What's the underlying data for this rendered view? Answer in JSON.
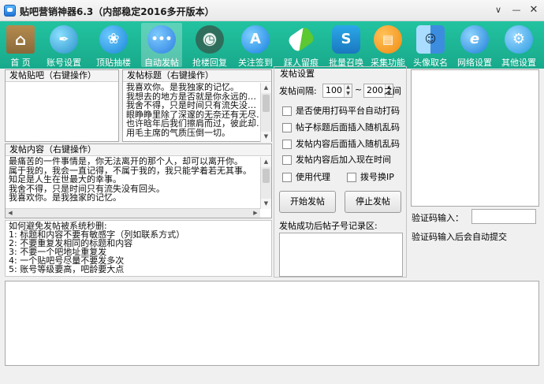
{
  "window": {
    "title": "贴吧营销神器6.3（内部稳定2016多开版本）"
  },
  "toolbar": {
    "items": [
      {
        "label": "首 页",
        "icon": "home-icon",
        "color": "#8a6a3a"
      },
      {
        "label": "账号设置",
        "icon": "feather-icon",
        "color": "#3aa8d8"
      },
      {
        "label": "顶贴抽楼",
        "icon": "bird-icon",
        "color": "#1e9be0"
      },
      {
        "label": "自动发帖",
        "icon": "chat-bubble-icon",
        "color": "#2b8be6"
      },
      {
        "label": "抢楼回复",
        "icon": "clock-icon",
        "color": "#2f6e5c"
      },
      {
        "label": "关注签到",
        "icon": "app-store-icon",
        "color": "#1f8fe8"
      },
      {
        "label": "踩人留痕",
        "icon": "pill-icon",
        "color": "#5cc832"
      },
      {
        "label": "批量召唤",
        "icon": "skype-icon",
        "color": "#1e86c8"
      },
      {
        "label": "采集功能",
        "icon": "book-icon",
        "color": "#f29a1c"
      },
      {
        "label": "头像取名",
        "icon": "finder-face-icon",
        "color": "#3c8de0"
      },
      {
        "label": "网络设置",
        "icon": "ie-icon",
        "color": "#2a8fe0"
      },
      {
        "label": "其他设置",
        "icon": "gear-icon",
        "color": "#39a7e3"
      }
    ]
  },
  "post_bar_panel": {
    "header": "发帖贴吧（右键操作）"
  },
  "title_panel": {
    "header": "发帖标题（右键操作）",
    "lines": [
      "我喜欢你。是我独家的记忆。",
      "我想去的地方是否就是你永远的…",
      "我舍不得，只是时间只有流失没…",
      "眼睁睁里除了深邃的无奈还有无尽…",
      "也许晗年后我们擦肩而过，彼此却…",
      "用毛主席的气质压倒一切。"
    ]
  },
  "content_panel": {
    "header": "发帖内容（右键操作）",
    "lines": [
      "最痛苦的一件事情是，你无法离开的那个人，却可以离开你。",
      "属于我的，我会一直记得，不属于我的，我只能学着若无其事。",
      "知足是人生在世最大的幸事。",
      "我舍不得，只是时间只有流失没有回头。",
      "我喜欢你。是我独家的记忆。"
    ]
  },
  "tips": {
    "lines": [
      "如何避免发帖被系统秒删:",
      "1: 标题和内容不要有敏感字（列如联系方式）",
      "2: 不要重复发相同的标题和内容",
      "3: 不要一个吧地址重复发",
      "4: 一个贴吧号尽量不要发多次",
      "5: 账号等级要高，吧龄要大点"
    ]
  },
  "settings": {
    "header": "发帖设置",
    "interval_label": "发帖间隔:",
    "interval_min": "100",
    "interval_sep": "~",
    "interval_max": "200",
    "interval_unit": "之间",
    "checkboxes": [
      "是否使用打码平台自动打码",
      "帖子标题后面插入随机乱码",
      "发帖内容后面插入随机乱码",
      "发帖内容后加入现在时间"
    ],
    "use_proxy": "使用代理",
    "dial_ip": "拨号换IP",
    "start_button": "开始发帖",
    "stop_button": "停止发帖",
    "record_label": "发帖成功后帖子号记录区:"
  },
  "captcha": {
    "input_label": "验证码输入：",
    "hint": "验证码输入后会自动提交"
  }
}
